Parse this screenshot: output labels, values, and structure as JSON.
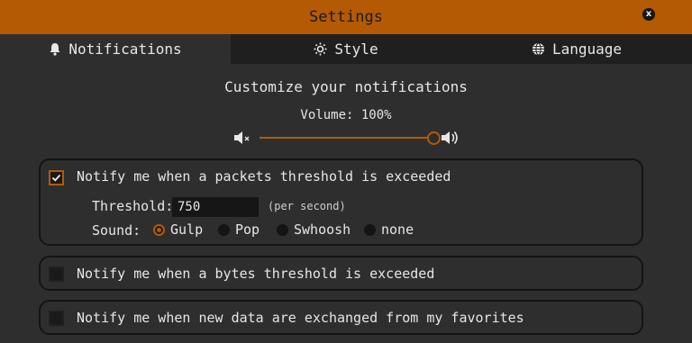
{
  "window": {
    "title": "Settings",
    "close_label": "x"
  },
  "tabs": [
    {
      "label": "Notifications",
      "icon": "bell-icon",
      "active": true
    },
    {
      "label": "Style",
      "icon": "sun-icon",
      "active": false
    },
    {
      "label": "Language",
      "icon": "globe-icon",
      "active": false
    }
  ],
  "notifications": {
    "heading": "Customize your notifications",
    "volume_label": "Volume: 100%",
    "volume_value": 100,
    "packets": {
      "checked": true,
      "label": "Notify me when a packets threshold is exceeded",
      "threshold_label": "Threshold:",
      "threshold_value": "750",
      "threshold_unit": "(per second)",
      "sound_label": "Sound:",
      "sound_options": [
        "Gulp",
        "Pop",
        "Swhoosh",
        "none"
      ],
      "sound_selected": "Gulp"
    },
    "bytes": {
      "checked": false,
      "label": "Notify me when a bytes threshold is exceeded"
    },
    "favorites": {
      "checked": false,
      "label": "Notify me when new data are exchanged from my favorites"
    }
  },
  "colors": {
    "accent": "#b45a05",
    "background": "#2e2e2e",
    "tab_inactive": "#1f1f1f"
  }
}
